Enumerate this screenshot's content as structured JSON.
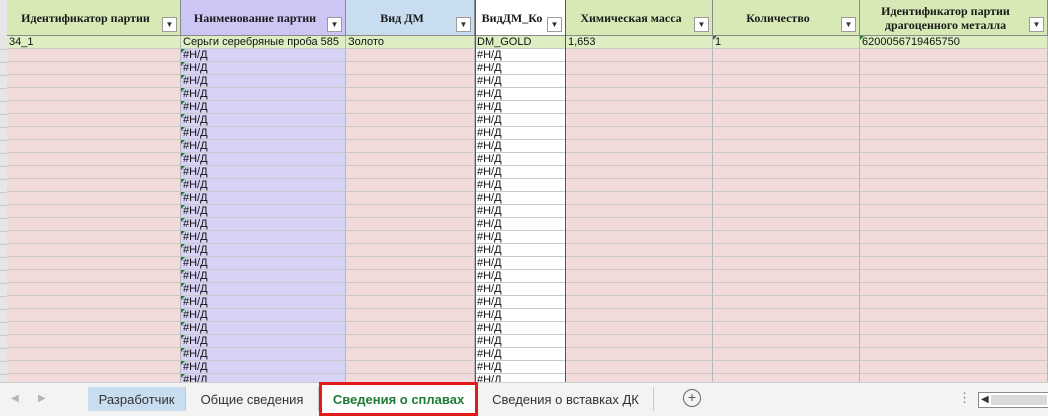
{
  "sheet": {
    "columns": [
      {
        "header": "Идентификатор партии",
        "style": "green",
        "filter_icon": "dropdown-arrow",
        "cell_style": "pink"
      },
      {
        "header": "Наименование партии",
        "style": "purple",
        "filter_icon": "dropdown-arrow",
        "cell_style": "lav"
      },
      {
        "header": "Вид ДМ",
        "style": "blue",
        "filter_icon": "dropdown-arrow",
        "cell_style": "pink"
      },
      {
        "header": "ВидДМ_Ко",
        "style": "white",
        "filter_icon": "dropdown-arrow",
        "cell_style": "wht"
      },
      {
        "header": "Химическая масса",
        "style": "green",
        "filter_icon": "dropdown-arrow",
        "cell_style": "pink"
      },
      {
        "header": "Количество",
        "style": "green",
        "filter_icon": "dropdown-arrow",
        "cell_style": "pink"
      },
      {
        "header": "Идентификатор партии драгоценного металла",
        "style": "green",
        "filter_icon": "dropdown-arrow",
        "cell_style": "pink"
      }
    ],
    "first_row": [
      "34_1",
      "Серьги серебряные проба 585",
      "Золото",
      "DM_GOLD",
      "1,653",
      "1",
      "6200056719465750"
    ],
    "na_value": "#Н/Д",
    "empty_rows": 26,
    "selected_column_index": 3
  },
  "tabs": [
    {
      "label": "Разработчик",
      "state": "highlighted"
    },
    {
      "label": "Общие сведения",
      "state": "normal"
    },
    {
      "label": "Сведения о сплавах",
      "state": "active"
    },
    {
      "label": "Сведения о вставках ДК",
      "state": "normal"
    }
  ],
  "tabbar_icons": {
    "prev": "chevron-left-icon",
    "next": "chevron-right-icon",
    "add": "plus-circle-icon",
    "more": "ellipsis-icon"
  },
  "colors": {
    "header_green": "#d7eab6",
    "header_purple": "#ccc6f5",
    "header_blue": "#c9ddf0",
    "cell_pink": "#f2dcdb",
    "cell_lavender": "#d6d3f5",
    "first_row_green": "#ddeec3",
    "active_tab_text": "#1e7a35",
    "highlight_border": "#e11a1a"
  }
}
